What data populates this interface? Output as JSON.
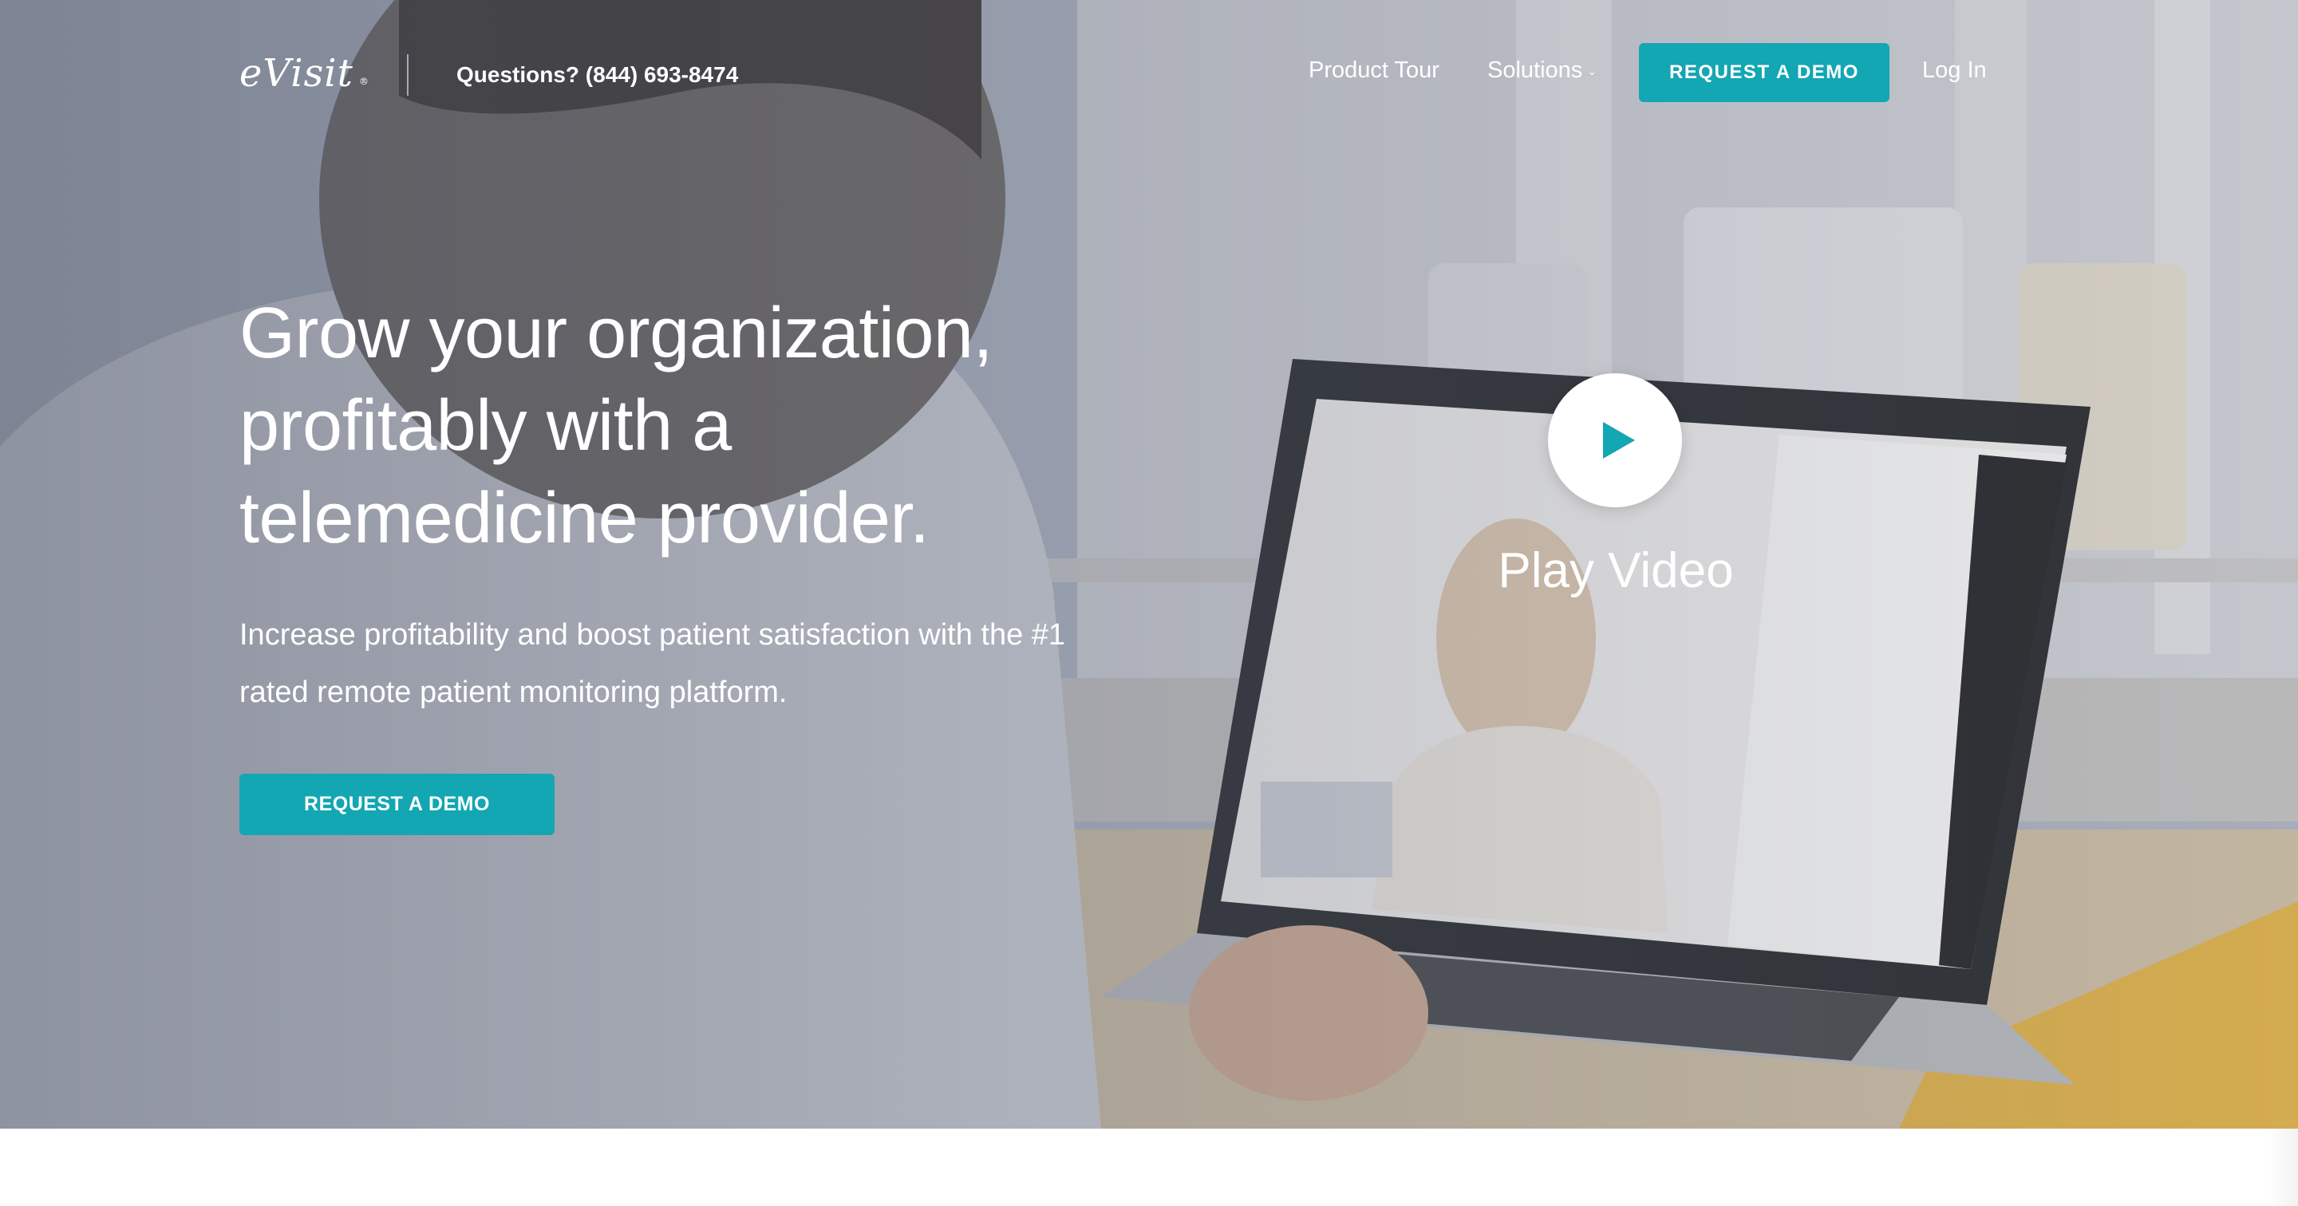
{
  "header": {
    "logo_text": "eVisit",
    "phone": "Questions? (844) 693-8474",
    "nav": {
      "product_tour": "Product Tour",
      "solutions": "Solutions",
      "request_demo": "REQUEST A DEMO",
      "login": "Log In"
    }
  },
  "hero": {
    "headline_lines": [
      "Grow your organization,",
      "profitably with a",
      "telemedicine provider."
    ],
    "subtext_lines": [
      "Increase profitability and boost patient satisfaction with the #1",
      "rated remote patient monitoring platform."
    ],
    "cta": "REQUEST A DEMO",
    "play_label": "Play Video"
  },
  "icons": {
    "play": "play-icon",
    "solutions_caret": "chevron-down-icon"
  },
  "colors": {
    "accent": "#13a6b3",
    "text_on_hero": "#ffffff"
  }
}
